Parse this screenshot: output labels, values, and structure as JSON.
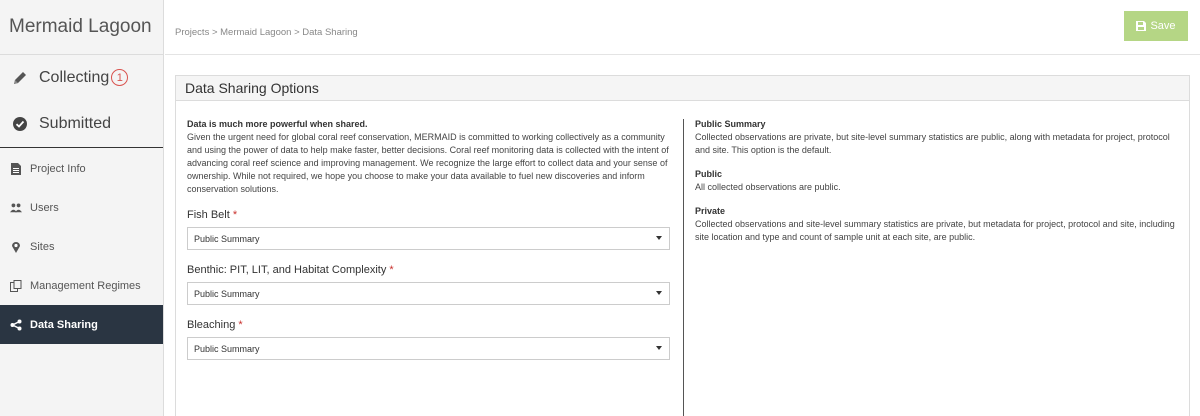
{
  "sidebar": {
    "project_name": "Mermaid Lagoon",
    "collecting_label": "Collecting",
    "collecting_badge": "1",
    "submitted_label": "Submitted",
    "items": [
      {
        "label": "Project Info",
        "icon": "document-icon"
      },
      {
        "label": "Users",
        "icon": "users-icon"
      },
      {
        "label": "Sites",
        "icon": "map-marker-icon"
      },
      {
        "label": "Management Regimes",
        "icon": "copy-icon"
      },
      {
        "label": "Data Sharing",
        "icon": "share-icon",
        "active": true
      }
    ]
  },
  "header": {
    "breadcrumb": "Projects > Mermaid Lagoon > Data Sharing",
    "save_label": "Save"
  },
  "panel": {
    "title": "Data Sharing Options",
    "intro_title": "Data is much more powerful when shared.",
    "intro_text": "Given the urgent need for global coral reef conservation, MERMAID is committed to working collectively as a community and using the power of data to help make faster, better decisions. Coral reef monitoring data is collected with the intent of advancing coral reef science and improving management. We recognize the large effort to collect data and your sense of ownership. While not required, we hope you choose to make your data available to fuel new discoveries and inform conservation solutions.",
    "fields": [
      {
        "label": "Fish Belt",
        "value": "Public Summary"
      },
      {
        "label": "Benthic: PIT, LIT, and Habitat Complexity",
        "value": "Public Summary"
      },
      {
        "label": "Bleaching",
        "value": "Public Summary"
      }
    ],
    "required_mark": "*",
    "options": [
      {
        "title": "Public Summary",
        "text": "Collected observations are private, but site-level summary statistics are public, along with metadata for project, protocol and site. This option is the default."
      },
      {
        "title": "Public",
        "text": "All collected observations are public."
      },
      {
        "title": "Private",
        "text": "Collected observations and site-level summary statistics are private, but metadata for project, protocol and site, including site location and type and count of sample unit at each site, are public."
      }
    ]
  },
  "colors": {
    "save_button": "#b5d685",
    "active_nav": "#2a3542",
    "badge": "#d9534f",
    "required": "#c9302c"
  }
}
